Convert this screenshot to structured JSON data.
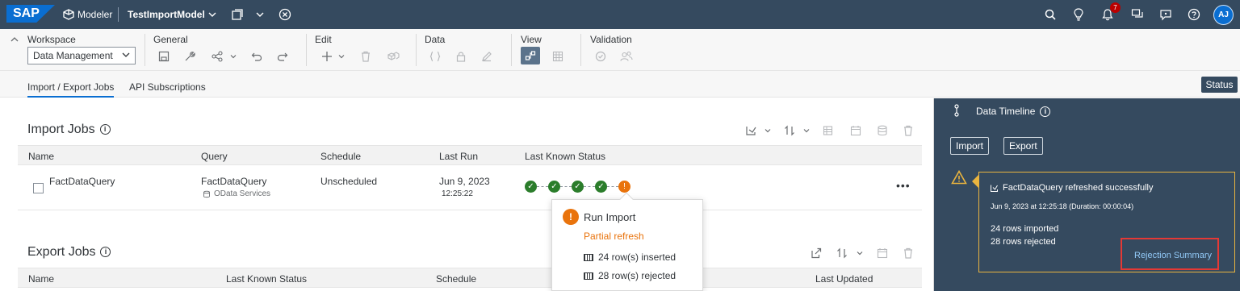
{
  "shell": {
    "logo": "SAP",
    "app_name": "Modeler",
    "model_name": "TestImportModel",
    "notification_count": "7",
    "avatar_initials": "AJ"
  },
  "toolbar": {
    "workspace_label": "Workspace",
    "workspace_value": "Data Management",
    "general_label": "General",
    "edit_label": "Edit",
    "data_label": "Data",
    "view_label": "View",
    "validation_label": "Validation"
  },
  "tabs": [
    {
      "label": "Import / Export Jobs",
      "active": true
    },
    {
      "label": "API Subscriptions",
      "active": false
    }
  ],
  "status_button": "Status",
  "import_jobs": {
    "title": "Import Jobs",
    "columns": [
      "Name",
      "Query",
      "Schedule",
      "Last Run",
      "Last Known Status"
    ],
    "rows": [
      {
        "name": "FactDataQuery",
        "query": "FactDataQuery",
        "query_source": "OData Services",
        "schedule": "Unscheduled",
        "last_run_date": "Jun 9, 2023",
        "last_run_time": "12:25:22",
        "statuses": [
          "success",
          "success",
          "success",
          "success",
          "warning"
        ]
      }
    ]
  },
  "export_jobs": {
    "title": "Export Jobs",
    "columns": [
      "Name",
      "Last Known Status",
      "Schedule",
      "Last Updated"
    ]
  },
  "popover": {
    "title": "Run Import",
    "subtitle": "Partial refresh",
    "inserted": "24 row(s) inserted",
    "rejected": "28 row(s) rejected"
  },
  "panel": {
    "title": "Data Timeline",
    "import_button": "Import",
    "export_button": "Export",
    "notification": {
      "headline": "FactDataQuery refreshed successfully",
      "timestamp": "Jun 9, 2023 at 12:25:18 (Duration: 00:00:04)",
      "imported": "24 rows imported",
      "rejected": "28 rows rejected",
      "link": "Rejection Summary"
    }
  },
  "colors": {
    "shell": "#354a5f",
    "accent": "#0a6ed1",
    "success": "#2b7d2b",
    "warning": "#e9730c",
    "highlight": "#e53935"
  }
}
